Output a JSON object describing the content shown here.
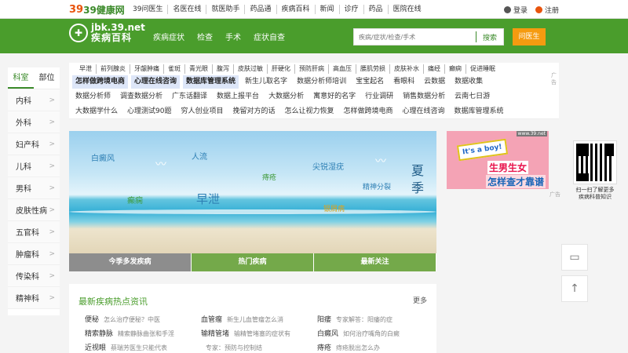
{
  "topbar": {
    "logo": "39健康网",
    "logo_num": "39",
    "links": [
      "39问医生",
      "名医在线",
      "就医助手",
      "药品通",
      "疾病百科",
      "新闻",
      "诊疗",
      "药品",
      "医院在线"
    ],
    "login": "登录",
    "register": "注册"
  },
  "nav": {
    "brand_mark": "jbk",
    "brand_line1": "jbk.39.net",
    "brand_line2": "疾病百科",
    "links": [
      "疾病症状",
      "检查",
      "手术",
      "症状自查"
    ],
    "search_placeholder": "疾病/症状/检查/手术",
    "search_button": "搜索",
    "ask_button": "问医生"
  },
  "sidebar": {
    "tabs": [
      "科室",
      "部位"
    ],
    "items": [
      "内科",
      "外科",
      "妇产科",
      "儿科",
      "男科",
      "皮肤性病",
      "五官科",
      "肿瘤科",
      "传染科",
      "精神科"
    ]
  },
  "tags": {
    "top_line": [
      "早泄",
      "前列腺炎",
      "牙龈肿痛",
      "雀斑",
      "青光眼",
      "腹泻",
      "皮肤过敏",
      "肝硬化",
      "预防肝病",
      "高血压",
      "腰肌劳损",
      "皮肤补水",
      "痛经",
      "癫痫",
      "促进睡眠"
    ],
    "row2": [
      "怎样做跨境电商",
      "心理在线咨询",
      "数据库管理系统",
      "新生儿取名字",
      "数据分析师培训",
      "宝宝起名",
      "看眼科",
      "云数据",
      "数据收集"
    ],
    "row3": [
      "数据分析师",
      "调查数据分析",
      "广东话翻译",
      "数据上报平台",
      "大数据分析",
      "寓意好的名字",
      "行业调研",
      "销售数据分析",
      "云南七日游"
    ],
    "row4": [
      "大数据学什么",
      "心理测试90题",
      "穷人创业项目",
      "挽留对方的话",
      "怎么让视力恢复",
      "怎样做跨境电商",
      "心理在线咨询",
      "数据库管理系统"
    ],
    "ad_label": "广告"
  },
  "banner": {
    "words": [
      "白癜风",
      "人流",
      "痔疮",
      "尖锐湿疣",
      "癫痫",
      "早泄",
      "精神分裂",
      "银屑病"
    ],
    "season": "夏季",
    "tabs": [
      "今季多发疾病",
      "热门疾病",
      "最新关注"
    ]
  },
  "ad": {
    "source": "www.39.net",
    "line1": "It's a boy!",
    "line2": "生男生女",
    "line3": "怎样查才靠谱",
    "ad_label": "广告"
  },
  "qr": {
    "caption1": "扫一扫了解更多",
    "caption2": "疾病科普知识"
  },
  "float": {
    "feedback_icon": "chat-icon",
    "top_icon": "arrow-up-icon"
  },
  "news": {
    "title": "最新疾病热点资讯",
    "more": "更多",
    "rows": [
      [
        [
          "便秘",
          "怎么治疗便秘？中医"
        ],
        [
          "血管瘤",
          "新生儿血管瘤怎么消"
        ],
        [
          "阳痿",
          "专家解答：阳痿的症"
        ]
      ],
      [
        [
          "精索静脉",
          "精索静脉曲张和手淫"
        ],
        [
          "输精管堵",
          "输精管堵塞的症状有"
        ],
        [
          "白癜风",
          "如何治疗嘴角的白癜"
        ]
      ],
      [
        [
          "近视眼",
          "蔡瑞芳医生只能代表"
        ],
        [
          "",
          "专家：预防与控制结"
        ],
        [
          "痔疮",
          "痔疮脱出怎么办"
        ]
      ]
    ]
  }
}
